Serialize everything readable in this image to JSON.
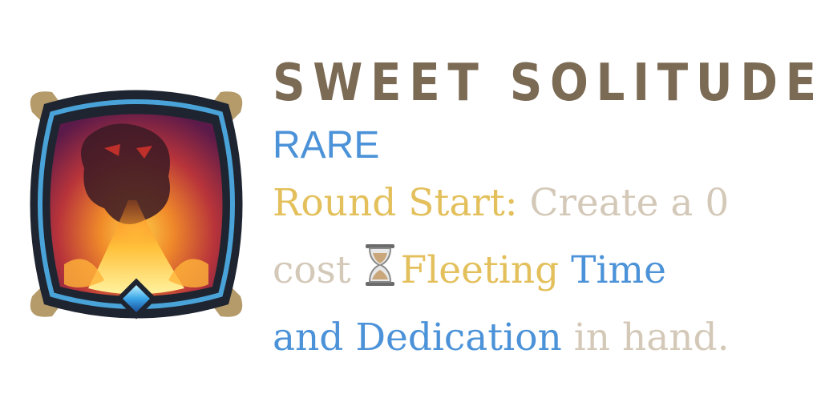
{
  "title": "SWEET SOLITUDE",
  "rarity": "RARE",
  "description": {
    "line1": {
      "keyword": "Round Start:",
      "text": " Create a 0"
    },
    "line2": {
      "text": "cost",
      "icon": "hourglass-icon",
      "keyword_gold": "Fleeting",
      "keyword_blue": "Time"
    },
    "line3": {
      "keyword_blue": "and Dedication",
      "text": " in hand."
    }
  },
  "colors": {
    "title": "#7b6a54",
    "rarity": "#4b92d8",
    "keyword_gold": "#e3c05b",
    "keyword_blue": "#4b92d8",
    "plain": "#d4c9b8"
  }
}
